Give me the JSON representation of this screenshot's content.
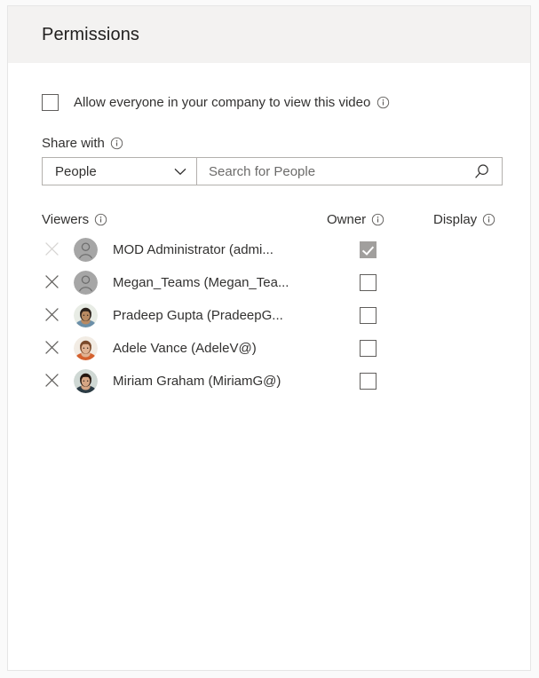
{
  "panel": {
    "title": "Permissions"
  },
  "allow_everyone": {
    "label": "Allow everyone in your company to view this video",
    "checked": false,
    "info_icon": "info-icon"
  },
  "share_with": {
    "label": "Share with",
    "info_icon": "info-icon",
    "dropdown": {
      "selected": "People",
      "chevron_icon": "chevron-down-icon",
      "options": [
        "People"
      ]
    },
    "search": {
      "value": "",
      "placeholder": "Search for People",
      "icon": "search-icon"
    }
  },
  "table": {
    "headers": {
      "viewers": "Viewers",
      "owner": "Owner",
      "display": "Display"
    },
    "header_info_icon": "info-icon",
    "remove_icon": "close-x-icon",
    "rows": [
      {
        "name": "MOD Administrator (admi...",
        "avatar_type": "placeholder",
        "owner_checked": true,
        "owner_disabled": true,
        "remove_disabled": true
      },
      {
        "name": "Megan_Teams (Megan_Tea...",
        "avatar_type": "placeholder",
        "owner_checked": false,
        "owner_disabled": false,
        "remove_disabled": false
      },
      {
        "name": "Pradeep Gupta (PradeepG...",
        "avatar_type": "photo",
        "avatar_colors": {
          "bg": "#e8ece5",
          "hair": "#2b211c",
          "skin": "#b98a62",
          "shirt": "#6b8fa8"
        },
        "owner_checked": false,
        "owner_disabled": false,
        "remove_disabled": false
      },
      {
        "name": "Adele Vance (AdeleV@)",
        "avatar_type": "photo",
        "avatar_colors": {
          "bg": "#f2ece4",
          "hair": "#7a4a2b",
          "skin": "#e0b393",
          "shirt": "#d4612e"
        },
        "owner_checked": false,
        "owner_disabled": false,
        "remove_disabled": false
      },
      {
        "name": "Miriam Graham (MiriamG@)",
        "avatar_type": "photo",
        "avatar_colors": {
          "bg": "#cfd8d4",
          "hair": "#24160f",
          "skin": "#d6a584",
          "shirt": "#2c3b44"
        },
        "owner_checked": false,
        "owner_disabled": false,
        "remove_disabled": false
      }
    ]
  },
  "colors": {
    "header_band": "#f3f2f1",
    "panel_border": "#e6e6e6",
    "text": "#323130",
    "title_text": "#201f1e",
    "placeholder_text": "#6c6b6a",
    "field_border": "#b3b0ad",
    "checkbox_border": "#605e5c",
    "checkbox_disabled_fill": "#a19f9d",
    "avatar_placeholder_bg": "#a6a6a6",
    "x_icon": "#605e5c",
    "x_icon_disabled": "#d6d4d2"
  }
}
